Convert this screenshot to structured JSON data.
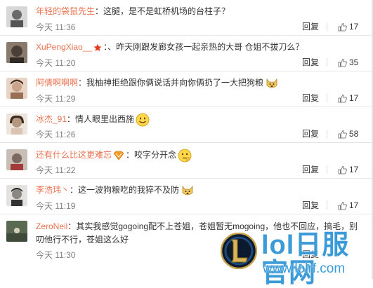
{
  "comments": [
    {
      "user": "年轻的袋鼠先生",
      "text": "这腿，是不是虹桥机场的台柱子？",
      "time": "今天 11:36",
      "reply": "回复",
      "likes": "17",
      "avatar_color": "#6a6a6a"
    },
    {
      "user": "XuPengXiao__",
      "text": "、昨天刚跟发廊女孩一起亲热的大哥 仓姐不拔刀么？",
      "time": "今天 11:20",
      "reply": "回复",
      "likes": "35",
      "avatar_color": "#4b4038"
    },
    {
      "user": "阿倩啊啊啊",
      "text": "我柚神拒绝跟你俩说话并向你俩扔了一大把狗粮",
      "time": "今天 11:29",
      "reply": "回复",
      "likes": "17",
      "avatar_color": "#c9a48a"
    },
    {
      "user": "冰杰_91",
      "text": "情人眼里出西施",
      "time": "今天 11:26",
      "reply": "回复",
      "likes": "58",
      "avatar_color": "#b5967f"
    },
    {
      "user": "还有什么比这更难忘",
      "text": "咬字分开念",
      "time": "今天 11:22",
      "reply": "回复",
      "likes": "17",
      "avatar_color": "#7c6a60"
    },
    {
      "user": "李浩玮丶",
      "text": "这一波狗粮吃的我猝不及防",
      "time": "今天 11:19",
      "reply": "回复",
      "likes": "17",
      "avatar_color": "#8b8682"
    },
    {
      "user": "ZeroNeil",
      "text": "其实我感觉gogoing配不上苍姐，苍姐暂无mogoing，他也不回应，搞毛，别叨他行不行，苍姐这么好",
      "time": "今天 11:30",
      "reply": "回复",
      "likes": "",
      "avatar_color": "#3f4a3a"
    }
  ],
  "separator": "：",
  "watermark": {
    "title": "lol日服官网",
    "url": "www.lolrf.com"
  },
  "colors": {
    "username": "#eb7350",
    "time": "#808080",
    "watermark": "#3b9bd8"
  }
}
